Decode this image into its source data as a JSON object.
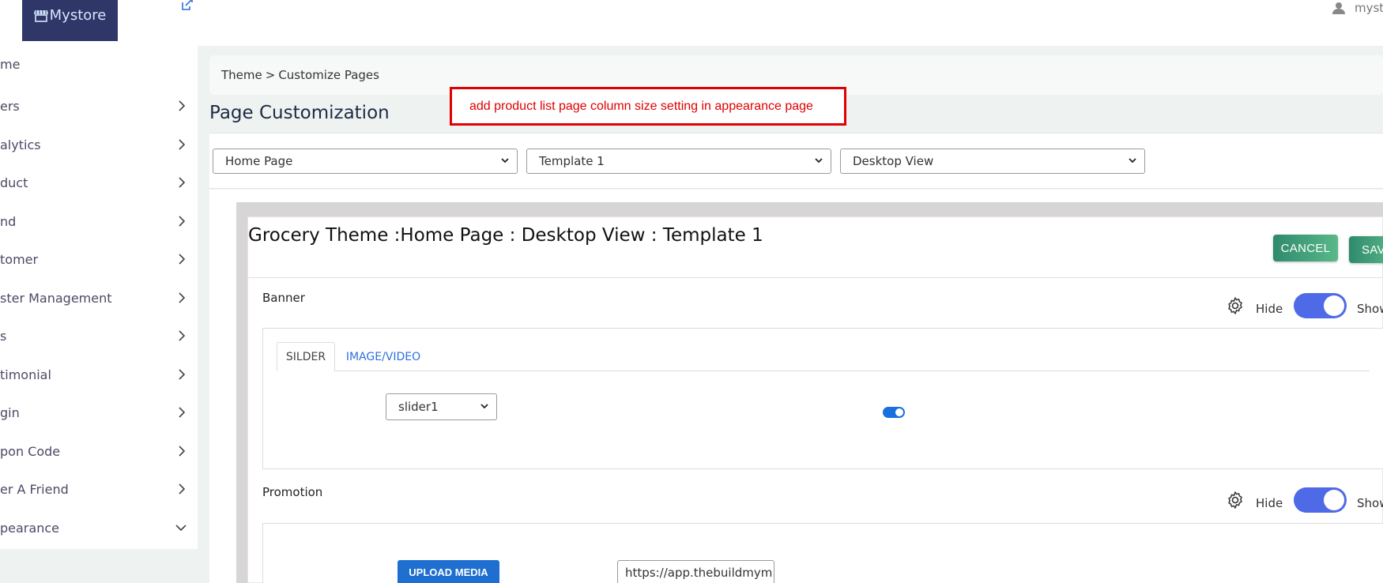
{
  "header": {
    "logo_text": "Mystore",
    "user_name": "myst"
  },
  "sidebar": {
    "items": [
      {
        "label": "me",
        "chevron": "none"
      },
      {
        "label": "ers",
        "chevron": "right"
      },
      {
        "label": "alytics",
        "chevron": "right"
      },
      {
        "label": "duct",
        "chevron": "right"
      },
      {
        "label": "nd",
        "chevron": "right"
      },
      {
        "label": "tomer",
        "chevron": "right"
      },
      {
        "label": "ster Management",
        "chevron": "right"
      },
      {
        "label": "s",
        "chevron": "right"
      },
      {
        "label": "timonial",
        "chevron": "right"
      },
      {
        "label": "gin",
        "chevron": "right"
      },
      {
        "label": "pon Code",
        "chevron": "right"
      },
      {
        "label": "er A Friend",
        "chevron": "right"
      },
      {
        "label": "pearance",
        "chevron": "down"
      }
    ]
  },
  "breadcrumb": {
    "root": "Theme",
    "separator": ">",
    "current": "Customize Pages"
  },
  "annotation": {
    "text": "add product list page column size setting in appearance page",
    "color": "#e00000"
  },
  "page_title": "Page Customization",
  "selects": {
    "page": "Home Page",
    "template": "Template 1",
    "view": "Desktop View"
  },
  "preview": {
    "title": "Grocery Theme :Home Page : Desktop View : Template 1",
    "cancel_label": "CANCEL",
    "save_label": "SAV",
    "banner": {
      "label": "Banner",
      "hide_label": "Hide",
      "show_label": "Show",
      "tabs": [
        "SILDER",
        "IMAGE/VIDEO"
      ],
      "slider_select": "slider1"
    },
    "promotion": {
      "label": "Promotion",
      "hide_label": "Hide",
      "show_label": "Show",
      "upload_label": "UPLOAD MEDIA",
      "url_value": "https://app.thebuildmym"
    }
  },
  "colors": {
    "accent": "#4f6ae6",
    "button_green": "#2f8a6c",
    "link_blue": "#2f6fe0",
    "navy": "#2f3768"
  }
}
